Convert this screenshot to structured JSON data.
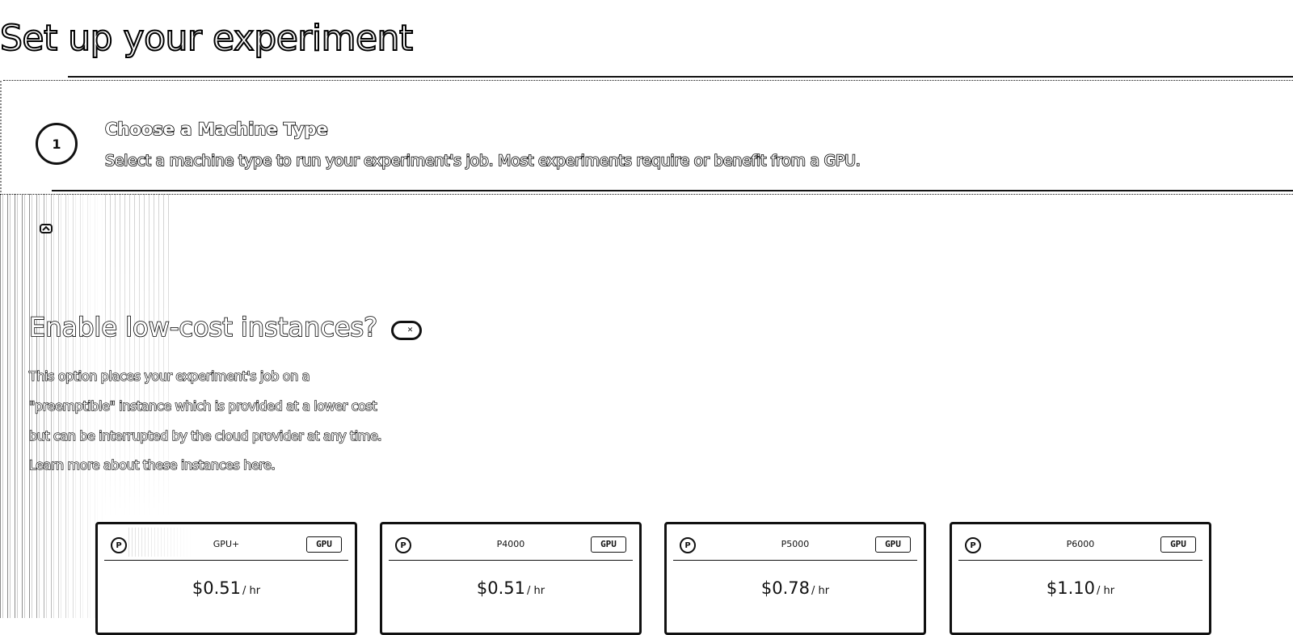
{
  "page": {
    "title": "Set up your experiment"
  },
  "step": {
    "number": "1",
    "title": "Choose a Machine Type",
    "description": "Select a machine type to run your experiment's job. Most experiments require or benefit from a GPU."
  },
  "low_cost": {
    "title": "Enable low-cost instances?",
    "toggle_state": "off",
    "description_lines": [
      "This option places your experiment's job on a",
      "\"preemptible\" instance which is provided at a lower cost",
      "but can be interrupted by the cloud provider at any time.",
      "Learn more about these instances here."
    ]
  },
  "machines": [
    {
      "name": "GPU+",
      "badge": "GPU",
      "price": "$0.51",
      "unit": "/ hr"
    },
    {
      "name": "P4000",
      "badge": "GPU",
      "price": "$0.51",
      "unit": "/ hr"
    },
    {
      "name": "P5000",
      "badge": "GPU",
      "price": "$0.78",
      "unit": "/ hr"
    },
    {
      "name": "P6000",
      "badge": "GPU",
      "price": "$1.10",
      "unit": "/ hr"
    }
  ],
  "icons": {
    "machine_logo": "paperspace-icon",
    "collapse": "chevron-up-icon",
    "toggle_off": "x-icon"
  }
}
